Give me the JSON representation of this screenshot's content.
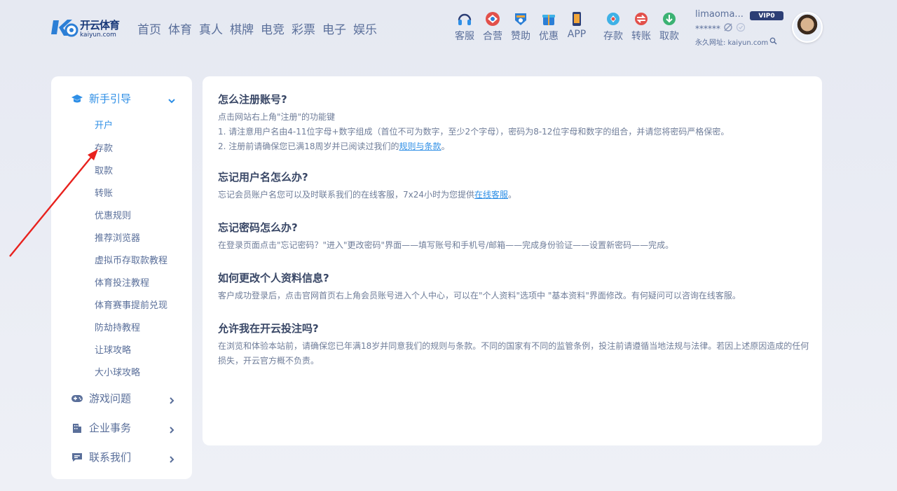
{
  "brand": {
    "name_cn": "开云体育",
    "name_en": "kaiyun.com"
  },
  "nav": [
    "首页",
    "体育",
    "真人",
    "棋牌",
    "电竞",
    "彩票",
    "电子",
    "娱乐"
  ],
  "tools": [
    {
      "label": "客服",
      "icon": "headset-icon"
    },
    {
      "label": "合营",
      "icon": "partner-icon"
    },
    {
      "label": "赞助",
      "icon": "sponsor-icon"
    },
    {
      "label": "优惠",
      "icon": "promo-icon"
    },
    {
      "label": "APP",
      "icon": "phone-icon"
    },
    {
      "label": "存款",
      "icon": "deposit-icon"
    },
    {
      "label": "转账",
      "icon": "transfer-icon"
    },
    {
      "label": "取款",
      "icon": "withdraw-icon"
    }
  ],
  "user": {
    "username": "limaoma...",
    "vip": "VIP0",
    "balance": "******",
    "domain": "永久网址: kaiyun.com"
  },
  "sidebar": {
    "sections": [
      {
        "label": "新手引导",
        "icon": "graduation-cap-icon",
        "expanded": true
      },
      {
        "label": "游戏问题",
        "icon": "gamepad-icon"
      },
      {
        "label": "企业事务",
        "icon": "building-icon"
      },
      {
        "label": "联系我们",
        "icon": "chat-icon"
      }
    ],
    "items": [
      "开户",
      "存款",
      "取款",
      "转账",
      "优惠规则",
      "推荐浏览器",
      "虚拟币存取款教程",
      "体育投注教程",
      "体育赛事提前兑现",
      "防劫持教程",
      "让球攻略",
      "大小球攻略"
    ]
  },
  "faq": [
    {
      "q": "怎么注册账号?",
      "a1": "点击网站右上角\"注册\"的功能键",
      "a2": "1. 请注意用户名由4-11位字母+数字组成（首位不可为数字，至少2个字母），密码为8-12位字母和数字的组合，并请您将密码严格保密。",
      "a3_pre": "2. 注册前请确保您已满18周岁并已阅读过我们的",
      "a3_link": "规则与条款",
      "a3_post": "。"
    },
    {
      "q": "忘记用户名怎么办?",
      "a_pre": "忘记会员账户名您可以及时联系我们的在线客服，7x24小时为您提供",
      "a_link": "在线客服",
      "a_post": "。"
    },
    {
      "q": "忘记密码怎么办?",
      "a": "在登录页面点击\"忘记密码？\"进入\"更改密码\"界面——填写账号和手机号/邮箱——完成身份验证——设置新密码——完成。"
    },
    {
      "q": "如何更改个人资料信息?",
      "a": "客户成功登录后，点击官网首页右上角会员账号进入个人中心，可以在\"个人资料\"选项中 \"基本资料\"界面修改。有何疑问可以咨询在线客服。"
    },
    {
      "q": "允许我在开云投注吗?",
      "a": "在浏览和体验本站前，请确保您已年满18岁并同意我们的规则与条款。不同的国家有不同的监管条例，投注前请遵循当地法规与法律。若因上述原因造成的任何损失，开云官方概不负责。"
    }
  ],
  "colors": {
    "accent": "#2f8fe6",
    "text": "#5a6f9a",
    "heading": "#394766",
    "annotation_arrow": "#e8211d"
  }
}
